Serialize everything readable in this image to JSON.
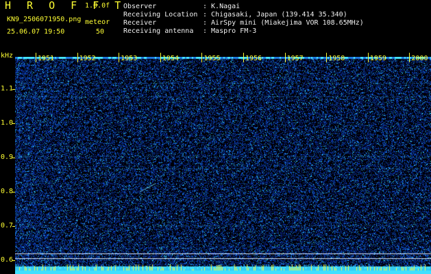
{
  "header": {
    "title": "H R O F F T",
    "version": "1.0.0f",
    "filename": "KN9_2506071950.png",
    "meteor_label": "meteor",
    "datetime": "25.06.07 19:50",
    "meteor_count": "50"
  },
  "info": [
    {
      "label": "Observer",
      "value": ": K.Nagai"
    },
    {
      "label": "Receiving Location",
      "value": ": Chigasaki, Japan (139.414 35.340)"
    },
    {
      "label": "Receiver",
      "value": ": AirSpy mini (Miakejima VOR 108.65MHz)"
    },
    {
      "label": "Receiving antenna",
      "value": ": Maspro FM-3"
    }
  ],
  "axis": {
    "unit": "kHz",
    "y_ticks": [
      "1.1",
      "1.0",
      "0.9",
      "0.8",
      "0.7",
      "0.6"
    ],
    "x_ticks": [
      "1951",
      "1952",
      "1953",
      "1954",
      "1955",
      "1956",
      "1957",
      "1958",
      "1959",
      "2000"
    ]
  },
  "colors": {
    "label": "#ffff33",
    "noise_low": "#0a1a9c",
    "noise_high": "#2ff0ff",
    "baseline": "#40e0ff"
  }
}
